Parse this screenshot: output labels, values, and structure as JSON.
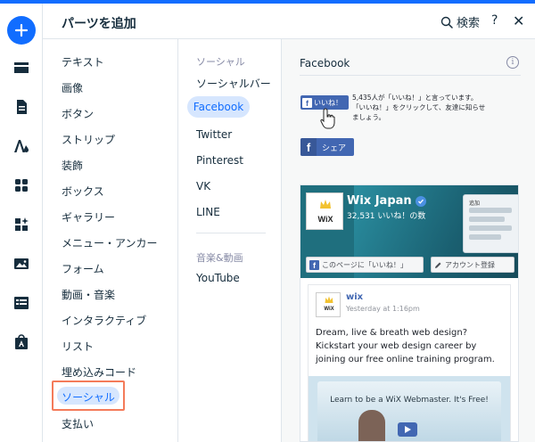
{
  "panel": {
    "title": "パーツを追加",
    "search_label": "検索",
    "help_label": "?",
    "close_label": "✕"
  },
  "rail": {
    "icons": [
      "add-icon",
      "strip-icon",
      "page-icon",
      "design-icon",
      "apps-icon",
      "app-market-icon",
      "media-icon",
      "table-icon",
      "store-icon"
    ]
  },
  "categories": [
    "テキスト",
    "画像",
    "ボタン",
    "ストリップ",
    "装飾",
    "ボックス",
    "ギャラリー",
    "メニュー・アンカー",
    "フォーム",
    "動画・音楽",
    "インタラクティブ",
    "リスト",
    "埋め込みコード",
    "ソーシャル",
    "支払い"
  ],
  "selected_category": "ソーシャル",
  "subcategories": {
    "social_header": "ソーシャル",
    "social_items": [
      "ソーシャルバー",
      "Facebook",
      "Twitter",
      "Pinterest",
      "VK",
      "LINE"
    ],
    "selected": "Facebook",
    "media_header": "音楽&動画",
    "media_items": [
      "YouTube"
    ]
  },
  "preview": {
    "title": "Facebook",
    "info_icon": "i",
    "like_button_label": "いいね！",
    "like_text": "5,435人が「いいね！」と言っています。「いいね！」をクリックして、友達に知らせましょう。",
    "share_button_label": "シェア",
    "page_plugin": {
      "logo_text": "WiX",
      "page_name": "Wix Japan",
      "likes_count": "32,531 いいね！の数",
      "cover_window_label": "追加",
      "like_page_label": "このページに「いいね！」",
      "account_label": "アカウント登録",
      "post_author": "wix",
      "post_time": "Yesterday at 1:16pm",
      "post_text": "Dream, live & breath web design? Kickstart your web design career by joining our free online training program.",
      "video_caption": "Learn to be a WiX Webmaster. It's Free!"
    }
  },
  "colors": {
    "accent": "#116dff",
    "selected_bg": "#d6e6fe",
    "highlight_border": "#f47b5a",
    "facebook_blue": "#4267b2"
  }
}
